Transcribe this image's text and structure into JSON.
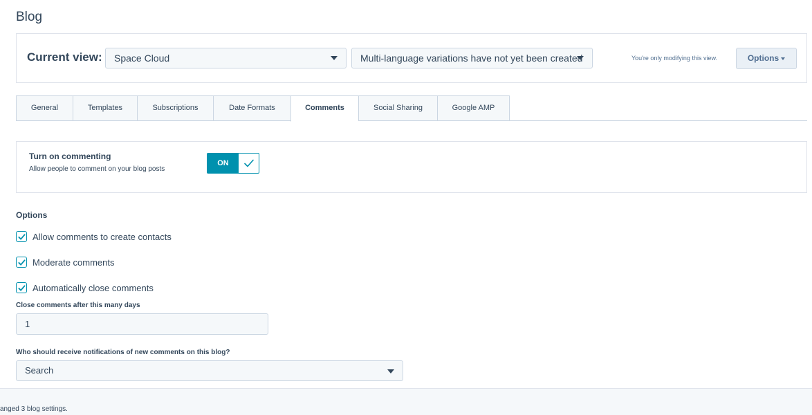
{
  "page": {
    "title": "Blog"
  },
  "view_panel": {
    "label": "Current view:",
    "view_select": "Space Cloud",
    "language_select": "Multi-language variations have not yet been created",
    "modify_note": "You're only modifying this view.",
    "options_label": "Options"
  },
  "tabs": [
    {
      "label": "General",
      "active": false
    },
    {
      "label": "Templates",
      "active": false
    },
    {
      "label": "Subscriptions",
      "active": false
    },
    {
      "label": "Date Formats",
      "active": false
    },
    {
      "label": "Comments",
      "active": true
    },
    {
      "label": "Social Sharing",
      "active": false
    },
    {
      "label": "Google AMP",
      "active": false
    }
  ],
  "commenting": {
    "title": "Turn on commenting",
    "subtitle": "Allow people to comment on your blog posts",
    "toggle_label": "ON",
    "enabled": true
  },
  "options": {
    "heading": "Options",
    "checkboxes": [
      {
        "label": "Allow comments to create contacts",
        "checked": true
      },
      {
        "label": "Moderate comments",
        "checked": true
      },
      {
        "label": "Automatically close comments",
        "checked": true
      }
    ],
    "close_days_label": "Close comments after this many days",
    "close_days_value": "1",
    "notify_label": "Who should receive notifications of new comments on this blog?",
    "notify_value": "Search"
  },
  "footer": {
    "status_text": "anged 3 blog settings."
  },
  "colors": {
    "accent": "#0091ae",
    "text": "#33475b",
    "border": "#cbd6e2",
    "field_bg": "#f5f8fa"
  }
}
